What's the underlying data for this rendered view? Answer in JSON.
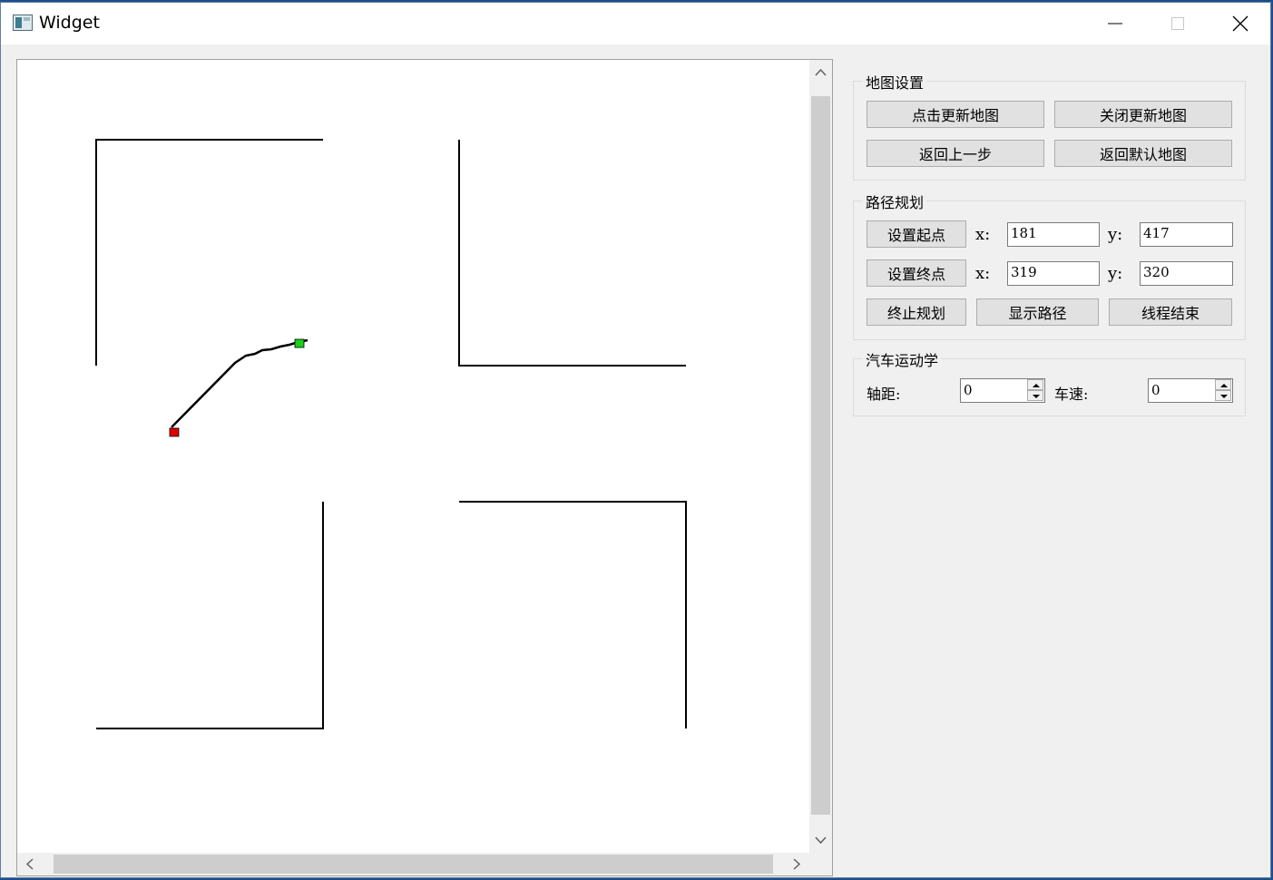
{
  "window": {
    "title": "Widget"
  },
  "map_settings": {
    "title": "地图设置",
    "update_map": "点击更新地图",
    "close_update": "关闭更新地图",
    "undo": "返回上一步",
    "default_map": "返回默认地图"
  },
  "path_planning": {
    "title": "路径规划",
    "set_start": "设置起点",
    "set_end": "设置终点",
    "x_label": "x:",
    "y_label": "y:",
    "start_x": "181",
    "start_y": "417",
    "end_x": "319",
    "end_y": "320",
    "stop": "终止规划",
    "show_path": "显示路径",
    "thread_end": "线程结束"
  },
  "car_kinematics": {
    "title": "汽车运动学",
    "wheelbase_label": "轴距:",
    "wheelbase_value": "0",
    "speed_label": "车速:",
    "speed_value": "0"
  },
  "colors": {
    "start_marker": "#e00000",
    "end_marker": "#19d119",
    "wall": "#000000",
    "path": "#000000"
  },
  "icons": [
    "minimize-icon",
    "maximize-icon",
    "close-icon",
    "scroll-up-icon",
    "scroll-down-icon",
    "scroll-left-icon",
    "scroll-right-icon",
    "spin-up-icon",
    "spin-down-icon"
  ]
}
